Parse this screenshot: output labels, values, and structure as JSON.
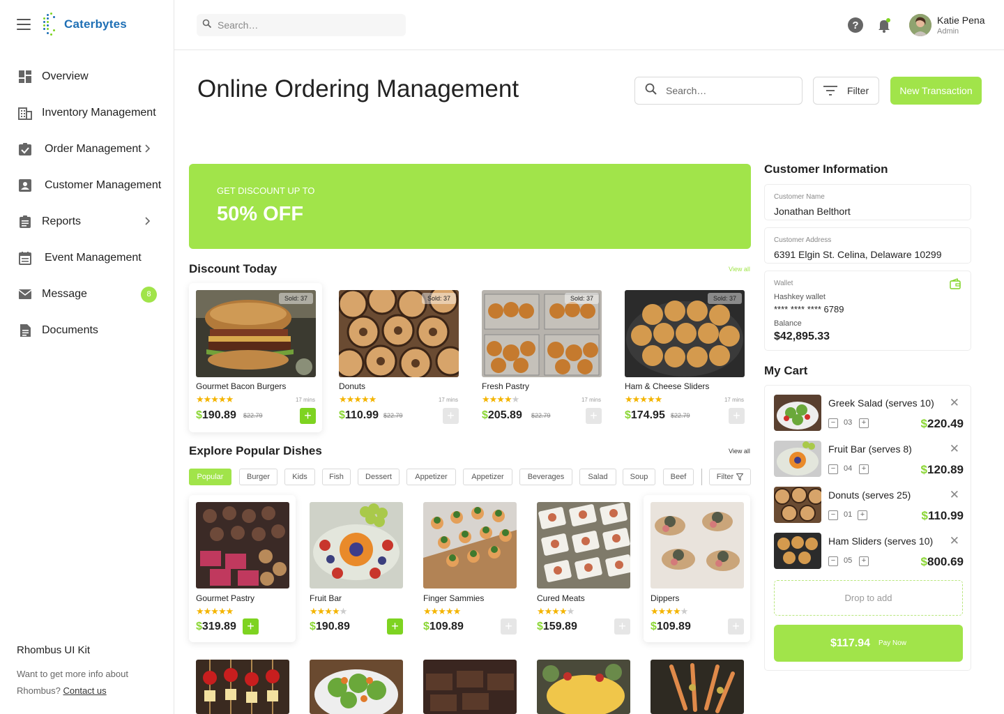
{
  "brand": {
    "name": "Caterbytes"
  },
  "sidebar": {
    "items": [
      {
        "label": "Overview",
        "icon": "dashboard-icon"
      },
      {
        "label": "Inventory Management",
        "icon": "building-icon"
      },
      {
        "label": "Order Management",
        "icon": "clipboard-check-icon"
      },
      {
        "label": "Customer Management",
        "icon": "user-card-icon"
      },
      {
        "label": "Reports",
        "icon": "clipboard-icon"
      },
      {
        "label": "Event Management",
        "icon": "calendar-icon"
      },
      {
        "label": "Message",
        "icon": "mail-icon",
        "badge": "8"
      },
      {
        "label": "Documents",
        "icon": "document-icon"
      }
    ],
    "footer": {
      "title": "Rhombus UI Kit",
      "text": "Want to get more info about Rhombus?",
      "link": "Contact us"
    }
  },
  "topbar": {
    "search_placeholder": "Search…",
    "user_name": "Katie Pena",
    "user_role": "Admin"
  },
  "header": {
    "title": "Online Ordering Management",
    "search_placeholder": "Search…",
    "filter_label": "Filter",
    "new_label": "New Transaction"
  },
  "banner": {
    "subtitle": "GET DISCOUNT UP TO",
    "headline": "50% OFF"
  },
  "discount": {
    "title": "Discount Today",
    "view_all": "View all",
    "items": [
      {
        "name": "Gourmet Bacon Burgers",
        "sold": "Sold: 37",
        "rating": 5,
        "mins": "17 mins",
        "currency": "$",
        "price": "190.89",
        "old_price": "$22.79",
        "added": true
      },
      {
        "name": "Donuts",
        "sold": "Sold: 37",
        "rating": 5,
        "mins": "17 mins",
        "currency": "$",
        "price": "110.99",
        "old_price": "$22.79",
        "added": false
      },
      {
        "name": "Fresh Pastry",
        "sold": "Sold: 37",
        "rating": 4,
        "mins": "17 mins",
        "currency": "$",
        "price": "205.89",
        "old_price": "$22.79",
        "added": false
      },
      {
        "name": "Ham & Cheese Sliders",
        "sold": "Sold: 37",
        "rating": 5,
        "mins": "17 mins",
        "currency": "$",
        "price": "174.95",
        "old_price": "$22.79",
        "added": false
      }
    ]
  },
  "popular": {
    "title": "Explore Popular Dishes",
    "view_all": "View all",
    "chips": [
      "Popular",
      "Burger",
      "Kids",
      "Fish",
      "Dessert",
      "Appetizer",
      "Appetizer",
      "Beverages",
      "Salad",
      "Soup",
      "Beef"
    ],
    "active_chip": "Popular",
    "filter_label": "Filter",
    "items": [
      {
        "name": "Gourmet Pastry",
        "rating": 5,
        "currency": "$",
        "price": "319.89",
        "added": true
      },
      {
        "name": "Fruit Bar",
        "rating": 4,
        "currency": "$",
        "price": "190.89",
        "added": true
      },
      {
        "name": "Finger Sammies",
        "rating": 5,
        "currency": "$",
        "price": "109.89",
        "added": false
      },
      {
        "name": "Cured Meats",
        "rating": 4,
        "currency": "$",
        "price": "159.89",
        "added": false
      },
      {
        "name": "Dippers",
        "rating": 4,
        "currency": "$",
        "price": "109.89",
        "added": false
      }
    ]
  },
  "customer": {
    "title": "Customer Information",
    "name_label": "Customer Name",
    "name": "Jonathan Belthort",
    "address_label": "Customer Address",
    "address": "6391 Elgin St. Celina, Delaware 10299",
    "wallet_label": "Wallet",
    "wallet_name": "Hashkey wallet",
    "wallet_number": "**** **** **** 6789",
    "balance_label": "Balance",
    "balance": "$42,895.33"
  },
  "cart": {
    "title": "My Cart",
    "items": [
      {
        "name": "Greek Salad (serves 10)",
        "qty": "03",
        "currency": "$",
        "price": "220.49"
      },
      {
        "name": "Fruit Bar (serves 8)",
        "qty": "04",
        "currency": "$",
        "price": "120.89"
      },
      {
        "name": "Donuts (serves 25)",
        "qty": "01",
        "currency": "$",
        "price": "110.99"
      },
      {
        "name": "Ham Sliders (serves 10)",
        "qty": "05",
        "currency": "$",
        "price": "800.69"
      }
    ],
    "drop_label": "Drop to add",
    "total": "$117.94",
    "pay_label": "Pay Now"
  },
  "colors": {
    "accent": "#a1e44a",
    "accent_dark": "#7ed321",
    "star": "#f4b400",
    "brand_blue": "#1e6fb5"
  }
}
